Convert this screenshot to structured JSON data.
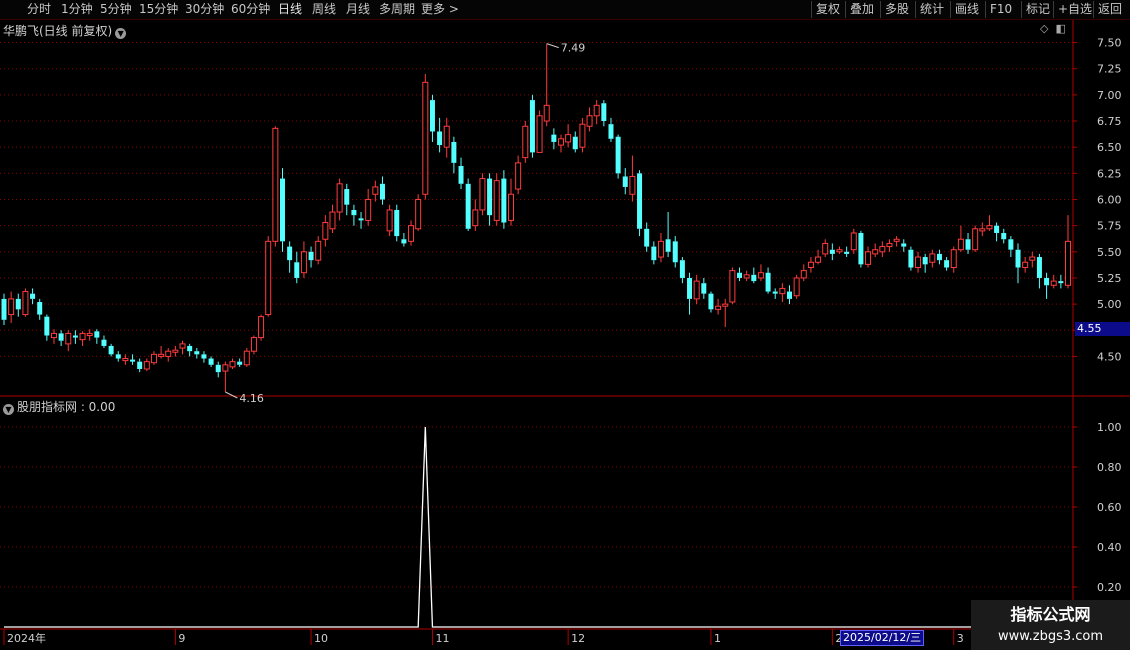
{
  "toolbar": {
    "periods": [
      "分时",
      "1分钟",
      "5分钟",
      "15分钟",
      "30分钟",
      "60分钟",
      "日线",
      "周线",
      "月线",
      "多周期",
      "更多 >"
    ],
    "active_period": "日线",
    "right_buttons": [
      "复权",
      "叠加",
      "多股",
      "统计",
      "画线",
      "F10",
      "标记",
      "+自选",
      "返回"
    ]
  },
  "main_chart": {
    "title": "华鹏飞(日线 前复权)",
    "high_label": "7.49",
    "low_label": "4.16",
    "current_price": "4.55",
    "y_ticks": [
      "7.50",
      "7.25",
      "7.00",
      "6.75",
      "6.50",
      "6.25",
      "6.00",
      "5.75",
      "5.50",
      "5.25",
      "5.00",
      "4.75",
      "4.50"
    ]
  },
  "indicator": {
    "title": "股朋指标网 : 0.00",
    "y_ticks": [
      "1.00",
      "0.80",
      "0.60",
      "0.40",
      "0.20"
    ]
  },
  "x_axis": {
    "labels": [
      "2024年",
      "9",
      "10",
      "11",
      "12",
      "1",
      "2",
      "3"
    ],
    "cursor_date": "2025/02/12/三"
  },
  "watermark": {
    "line1": "指标公式网",
    "line2": "www.zbgs3.com"
  },
  "colors": {
    "up": "#ff3c3c",
    "down": "#54ffff",
    "grid": "#8a0000",
    "axis": "#b00000",
    "badge": "#0c0c8a"
  },
  "chart_data": {
    "type": "candlestick",
    "ylim": [
      4.16,
      7.62
    ],
    "candles": [
      [
        5.05,
        4.85,
        5.1,
        4.8
      ],
      [
        4.9,
        5.05,
        5.12,
        4.82
      ],
      [
        5.05,
        4.95,
        5.1,
        4.88
      ],
      [
        4.9,
        5.12,
        5.15,
        4.88
      ],
      [
        5.1,
        5.05,
        5.15,
        5.0
      ],
      [
        5.02,
        4.9,
        5.05,
        4.85
      ],
      [
        4.88,
        4.7,
        4.9,
        4.65
      ],
      [
        4.68,
        4.72,
        4.76,
        4.62
      ],
      [
        4.72,
        4.65,
        4.75,
        4.6
      ],
      [
        4.62,
        4.72,
        4.75,
        4.55
      ],
      [
        4.7,
        4.68,
        4.75,
        4.62
      ],
      [
        4.66,
        4.72,
        4.74,
        4.6
      ],
      [
        4.7,
        4.72,
        4.76,
        4.65
      ],
      [
        4.74,
        4.68,
        4.76,
        4.62
      ],
      [
        4.66,
        4.6,
        4.7,
        4.58
      ],
      [
        4.6,
        4.52,
        4.62,
        4.5
      ],
      [
        4.52,
        4.48,
        4.55,
        4.45
      ],
      [
        4.46,
        4.48,
        4.52,
        4.42
      ],
      [
        4.47,
        4.45,
        4.52,
        4.42
      ],
      [
        4.45,
        4.38,
        4.48,
        4.35
      ],
      [
        4.38,
        4.45,
        4.48,
        4.36
      ],
      [
        4.44,
        4.52,
        4.55,
        4.42
      ],
      [
        4.5,
        4.52,
        4.6,
        4.48
      ],
      [
        4.5,
        4.55,
        4.58,
        4.45
      ],
      [
        4.54,
        4.56,
        4.6,
        4.5
      ],
      [
        4.58,
        4.62,
        4.65,
        4.52
      ],
      [
        4.6,
        4.55,
        4.62,
        4.5
      ],
      [
        4.55,
        4.52,
        4.58,
        4.48
      ],
      [
        4.52,
        4.48,
        4.55,
        4.44
      ],
      [
        4.48,
        4.42,
        4.5,
        4.4
      ],
      [
        4.42,
        4.35,
        4.45,
        4.3
      ],
      [
        4.36,
        4.42,
        4.45,
        4.16
      ],
      [
        4.4,
        4.45,
        4.48,
        4.38
      ],
      [
        4.45,
        4.42,
        4.48,
        4.4
      ],
      [
        4.42,
        4.55,
        4.58,
        4.4
      ],
      [
        4.55,
        4.68,
        4.7,
        4.52
      ],
      [
        4.68,
        4.88,
        4.9,
        4.65
      ],
      [
        4.9,
        5.6,
        5.65,
        4.88
      ],
      [
        5.6,
        6.68,
        6.7,
        5.55
      ],
      [
        6.2,
        5.6,
        6.3,
        5.5
      ],
      [
        5.55,
        5.42,
        5.6,
        5.3
      ],
      [
        5.4,
        5.25,
        5.5,
        5.2
      ],
      [
        5.3,
        5.5,
        5.6,
        5.25
      ],
      [
        5.5,
        5.42,
        5.55,
        5.35
      ],
      [
        5.42,
        5.6,
        5.65,
        5.38
      ],
      [
        5.62,
        5.78,
        5.85,
        5.55
      ],
      [
        5.72,
        5.88,
        5.95,
        5.68
      ],
      [
        5.88,
        6.15,
        6.2,
        5.8
      ],
      [
        6.1,
        5.95,
        6.15,
        5.85
      ],
      [
        5.9,
        5.85,
        5.95,
        5.75
      ],
      [
        5.82,
        5.8,
        5.88,
        5.72
      ],
      [
        5.8,
        6.0,
        6.1,
        5.75
      ],
      [
        6.05,
        6.12,
        6.18,
        5.98
      ],
      [
        6.15,
        6.0,
        6.22,
        5.95
      ],
      [
        5.7,
        5.9,
        5.95,
        5.65
      ],
      [
        5.9,
        5.65,
        5.95,
        5.6
      ],
      [
        5.62,
        5.58,
        5.68,
        5.55
      ],
      [
        5.6,
        5.75,
        5.8,
        5.56
      ],
      [
        5.72,
        6.0,
        6.05,
        5.7
      ],
      [
        6.05,
        7.12,
        7.2,
        6.0
      ],
      [
        6.95,
        6.65,
        7.0,
        6.55
      ],
      [
        6.65,
        6.52,
        6.78,
        6.45
      ],
      [
        6.5,
        6.7,
        6.78,
        6.4
      ],
      [
        6.55,
        6.35,
        6.6,
        6.25
      ],
      [
        6.32,
        6.15,
        6.4,
        6.1
      ],
      [
        6.15,
        5.72,
        6.2,
        5.7
      ],
      [
        5.75,
        5.9,
        6.0,
        5.7
      ],
      [
        5.9,
        6.2,
        6.25,
        5.85
      ],
      [
        6.2,
        5.85,
        6.25,
        5.75
      ],
      [
        5.8,
        6.18,
        6.25,
        5.75
      ],
      [
        6.2,
        5.78,
        6.28,
        5.72
      ],
      [
        5.8,
        6.05,
        6.2,
        5.75
      ],
      [
        6.1,
        6.35,
        6.42,
        6.05
      ],
      [
        6.4,
        6.7,
        6.75,
        6.35
      ],
      [
        6.95,
        6.45,
        7.0,
        6.4
      ],
      [
        6.45,
        6.8,
        6.85,
        6.45
      ],
      [
        6.75,
        6.9,
        7.49,
        6.7
      ],
      [
        6.62,
        6.55,
        6.68,
        6.48
      ],
      [
        6.52,
        6.58,
        6.62,
        6.45
      ],
      [
        6.55,
        6.62,
        6.72,
        6.5
      ],
      [
        6.6,
        6.48,
        6.65,
        6.45
      ],
      [
        6.5,
        6.72,
        6.78,
        6.45
      ],
      [
        6.7,
        6.8,
        6.88,
        6.65
      ],
      [
        6.8,
        6.9,
        6.95,
        6.72
      ],
      [
        6.92,
        6.75,
        6.95,
        6.7
      ],
      [
        6.72,
        6.58,
        6.78,
        6.55
      ],
      [
        6.6,
        6.25,
        6.62,
        6.2
      ],
      [
        6.22,
        6.12,
        6.3,
        6.05
      ],
      [
        6.05,
        6.22,
        6.42,
        5.98
      ],
      [
        6.25,
        5.72,
        6.28,
        5.65
      ],
      [
        5.72,
        5.55,
        5.78,
        5.5
      ],
      [
        5.55,
        5.42,
        5.6,
        5.38
      ],
      [
        5.45,
        5.6,
        5.68,
        5.4
      ],
      [
        5.62,
        5.5,
        5.88,
        5.45
      ],
      [
        5.6,
        5.4,
        5.65,
        5.35
      ],
      [
        5.42,
        5.25,
        5.45,
        5.2
      ],
      [
        5.25,
        5.05,
        5.3,
        4.9
      ],
      [
        5.05,
        5.22,
        5.28,
        5.0
      ],
      [
        5.2,
        5.1,
        5.25,
        5.05
      ],
      [
        5.1,
        4.95,
        5.12,
        4.92
      ],
      [
        4.95,
        4.98,
        5.05,
        4.9
      ],
      [
        4.98,
        5.0,
        5.05,
        4.78
      ],
      [
        5.02,
        5.32,
        5.35,
        5.0
      ],
      [
        5.3,
        5.25,
        5.35,
        5.22
      ],
      [
        5.25,
        5.28,
        5.32,
        5.22
      ],
      [
        5.28,
        5.22,
        5.35,
        5.2
      ],
      [
        5.25,
        5.3,
        5.38,
        5.22
      ],
      [
        5.3,
        5.12,
        5.35,
        5.1
      ],
      [
        5.12,
        5.1,
        5.15,
        5.05
      ],
      [
        5.1,
        5.15,
        5.2,
        5.02
      ],
      [
        5.12,
        5.05,
        5.18,
        5.0
      ],
      [
        5.08,
        5.25,
        5.28,
        5.05
      ],
      [
        5.25,
        5.32,
        5.38,
        5.22
      ],
      [
        5.35,
        5.4,
        5.45,
        5.3
      ],
      [
        5.4,
        5.45,
        5.52,
        5.38
      ],
      [
        5.48,
        5.58,
        5.62,
        5.45
      ],
      [
        5.52,
        5.48,
        5.58,
        5.42
      ],
      [
        5.5,
        5.52,
        5.55,
        5.48
      ],
      [
        5.5,
        5.48,
        5.55,
        5.45
      ],
      [
        5.52,
        5.68,
        5.72,
        5.48
      ],
      [
        5.68,
        5.38,
        5.7,
        5.35
      ],
      [
        5.38,
        5.5,
        5.55,
        5.35
      ],
      [
        5.48,
        5.52,
        5.58,
        5.45
      ],
      [
        5.5,
        5.55,
        5.6,
        5.45
      ],
      [
        5.55,
        5.58,
        5.62,
        5.5
      ],
      [
        5.6,
        5.62,
        5.65,
        5.55
      ],
      [
        5.58,
        5.55,
        5.62,
        5.5
      ],
      [
        5.52,
        5.35,
        5.55,
        5.32
      ],
      [
        5.35,
        5.45,
        5.5,
        5.3
      ],
      [
        5.45,
        5.38,
        5.48,
        5.3
      ],
      [
        5.4,
        5.48,
        5.52,
        5.35
      ],
      [
        5.48,
        5.42,
        5.52,
        5.38
      ],
      [
        5.42,
        5.35,
        5.45,
        5.32
      ],
      [
        5.35,
        5.52,
        5.55,
        5.3
      ],
      [
        5.52,
        5.62,
        5.75,
        5.5
      ],
      [
        5.62,
        5.52,
        5.68,
        5.48
      ],
      [
        5.52,
        5.72,
        5.75,
        5.5
      ],
      [
        5.7,
        5.72,
        5.78,
        5.65
      ],
      [
        5.72,
        5.75,
        5.85,
        5.7
      ],
      [
        5.75,
        5.68,
        5.78,
        5.6
      ],
      [
        5.68,
        5.62,
        5.72,
        5.58
      ],
      [
        5.62,
        5.52,
        5.65,
        5.45
      ],
      [
        5.52,
        5.35,
        5.58,
        5.2
      ],
      [
        5.35,
        5.4,
        5.45,
        5.3
      ],
      [
        5.42,
        5.45,
        5.5,
        5.35
      ],
      [
        5.45,
        5.25,
        5.48,
        5.15
      ],
      [
        5.25,
        5.18,
        5.3,
        5.05
      ],
      [
        5.18,
        5.22,
        5.28,
        5.15
      ],
      [
        5.22,
        5.2,
        5.28,
        5.15
      ],
      [
        5.18,
        5.6,
        5.85,
        5.15
      ]
    ],
    "indicator_values": [
      0,
      0,
      0,
      0,
      0,
      0,
      0,
      0,
      0,
      0,
      0,
      0,
      0,
      0,
      0,
      0,
      0,
      0,
      0,
      0,
      0,
      0,
      0,
      0,
      0,
      0,
      0,
      0,
      0,
      0,
      0,
      0,
      0,
      0,
      0,
      0,
      0,
      0,
      0,
      0,
      0,
      0,
      0,
      0,
      0,
      0,
      0,
      0,
      0,
      0,
      0,
      0,
      0,
      0,
      0,
      0,
      0,
      0,
      0,
      1.0,
      0,
      0,
      0,
      0,
      0,
      0,
      0,
      0,
      0,
      0,
      0,
      0,
      0,
      0,
      0,
      0,
      0,
      0,
      0,
      0,
      0,
      0,
      0,
      0,
      0,
      0,
      0,
      0,
      0,
      0,
      0,
      0,
      0,
      0,
      0,
      0,
      0,
      0,
      0,
      0,
      0,
      0,
      0,
      0,
      0,
      0,
      0,
      0,
      0,
      0,
      0,
      0,
      0,
      0,
      0,
      0,
      0,
      0,
      0,
      0,
      0,
      0,
      0,
      0,
      0,
      0,
      0,
      0,
      0,
      0,
      0,
      0,
      0,
      0,
      0,
      0,
      0,
      0,
      0,
      0,
      0,
      0,
      0,
      0,
      0,
      0,
      0,
      0,
      0,
      0,
      0,
      0
    ],
    "indicator_ylim": [
      0,
      1.1
    ],
    "x_tick_labels": [
      "2024年",
      "9",
      "10",
      "11",
      "12",
      "1",
      "2",
      "3"
    ],
    "x_tick_index": [
      0,
      24,
      43,
      60,
      79,
      99,
      116,
      133
    ]
  }
}
